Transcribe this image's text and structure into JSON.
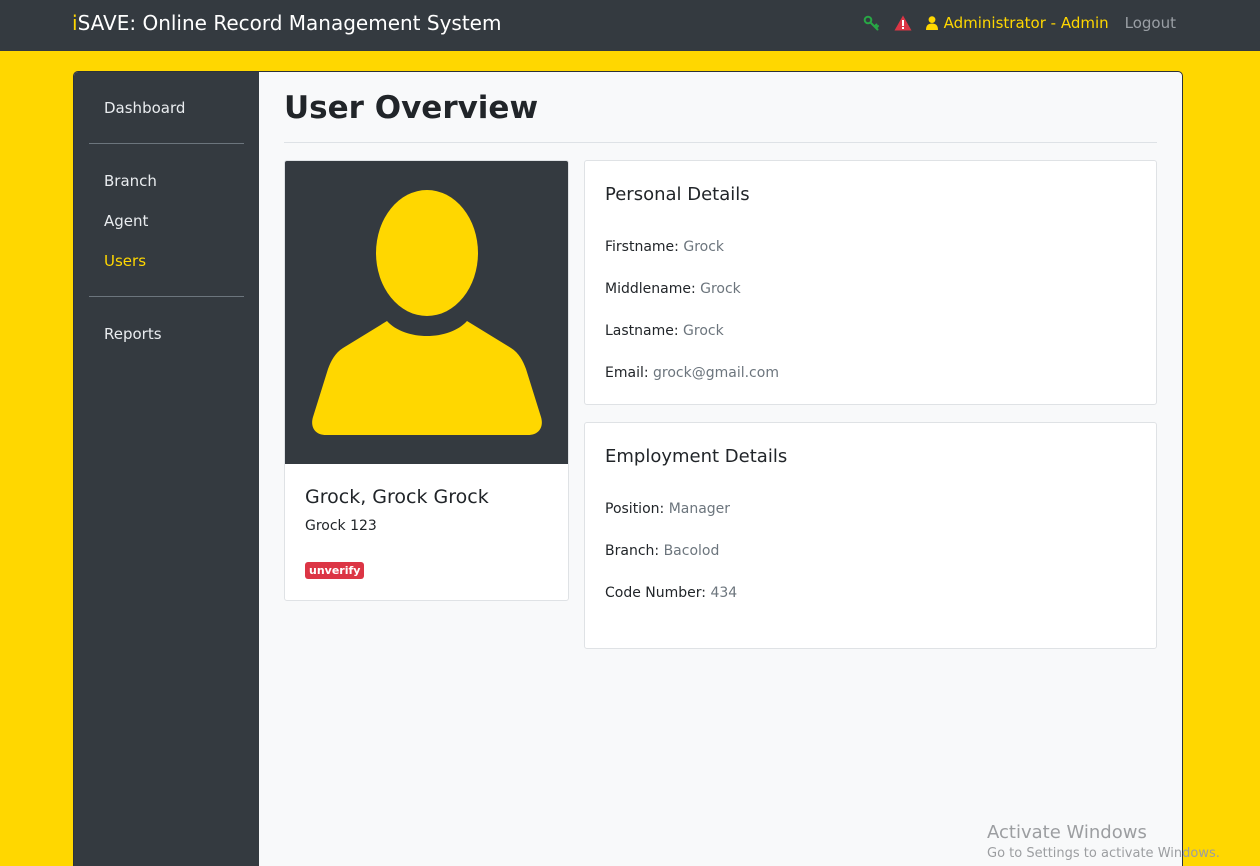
{
  "header": {
    "brand_prefix": "i",
    "brand_rest": "SAVE: Online Record Management System",
    "key_icon": "key-icon",
    "alert_icon": "warning-icon",
    "user_icon": "user-icon",
    "user_label": "Administrator - Admin",
    "logout_label": "Logout",
    "colors": {
      "bar": "#343a40",
      "accent": "#ffd700",
      "key": "#28a745",
      "alert": "#dc3545"
    }
  },
  "sidebar": {
    "items": [
      {
        "label": "Dashboard"
      },
      {
        "label": "Branch"
      },
      {
        "label": "Agent"
      },
      {
        "label": "Users",
        "active": true
      },
      {
        "label": "Reports"
      }
    ]
  },
  "main": {
    "title": "User Overview",
    "profile": {
      "avatar_icon": "person-avatar-icon",
      "name": "Grock, Grock Grock",
      "username": "Grock 123",
      "status_badge": "unverify"
    },
    "personal": {
      "title": "Personal Details",
      "rows": [
        {
          "label": "Firstname:",
          "value": "Grock"
        },
        {
          "label": "Middlename:",
          "value": "Grock"
        },
        {
          "label": "Lastname:",
          "value": "Grock"
        },
        {
          "label": "Email:",
          "value": "grock@gmail.com"
        }
      ]
    },
    "employment": {
      "title": "Employment Details",
      "rows": [
        {
          "label": "Position:",
          "value": "Manager"
        },
        {
          "label": "Branch:",
          "value": "Bacolod"
        },
        {
          "label": "Code Number:",
          "value": "434"
        }
      ]
    }
  },
  "watermark": {
    "line1": "Activate Windows",
    "line2": "Go to Settings to activate Windows."
  }
}
